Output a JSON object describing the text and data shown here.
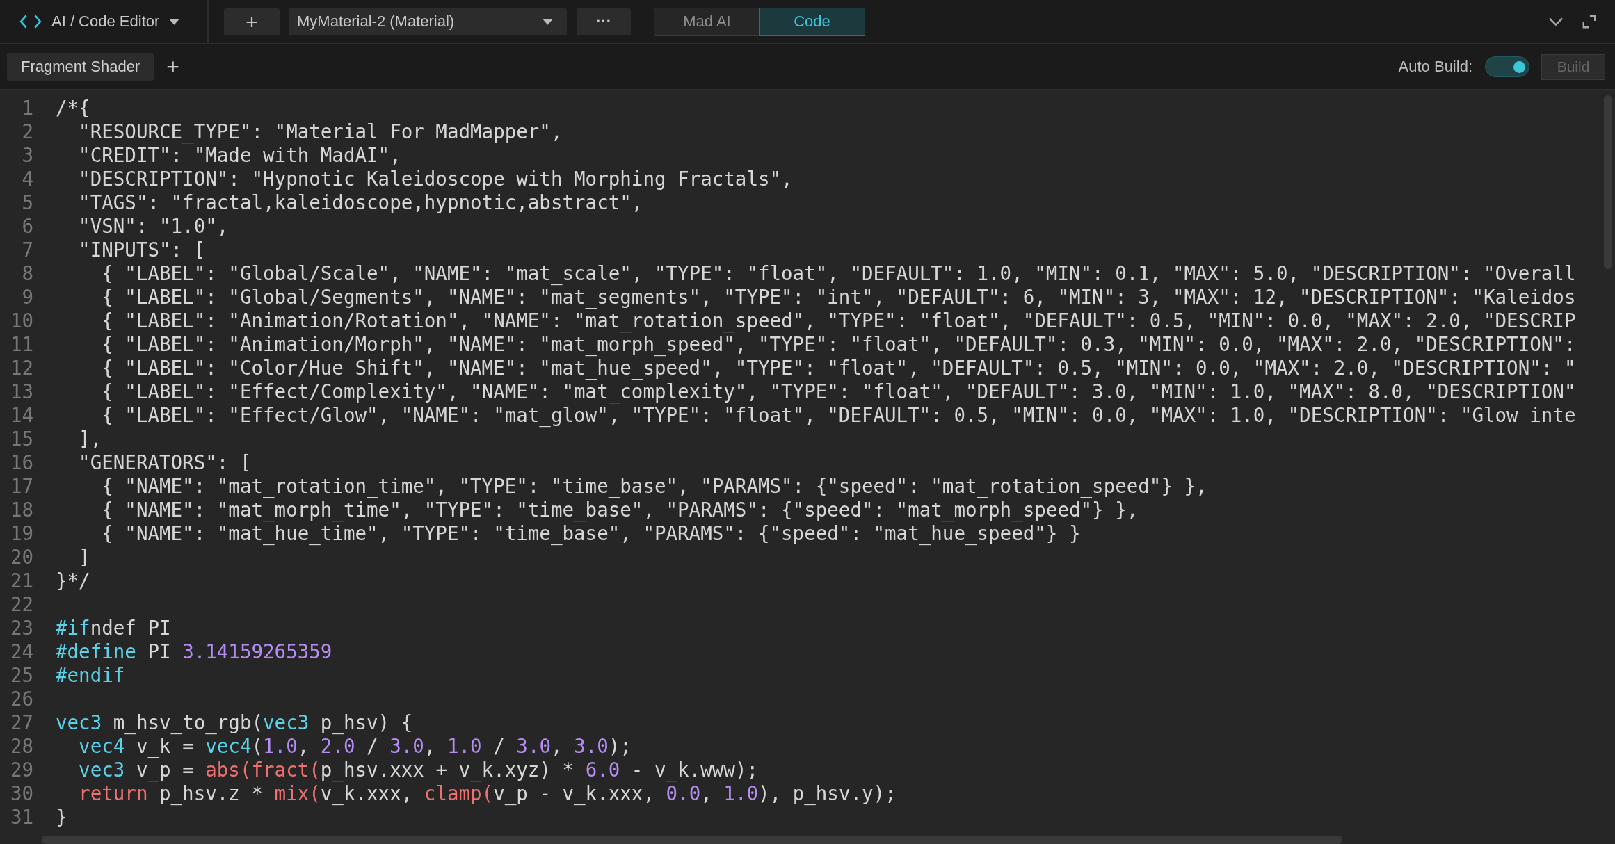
{
  "toolbar": {
    "title": "AI / Code Editor",
    "add_button": "+",
    "material_dropdown": "MyMaterial-2 (Material)",
    "more_button": "···",
    "modes": [
      {
        "label": "Mad AI",
        "selected": false
      },
      {
        "label": "Code",
        "selected": true
      }
    ]
  },
  "tab_bar": {
    "tabs": [
      {
        "label": "Fragment Shader",
        "selected": true
      }
    ],
    "add_tab": "+",
    "auto_build_label": "Auto Build:",
    "auto_build": {
      "on": true
    },
    "build_button": {
      "label": "Build",
      "disabled": true
    }
  },
  "editor": {
    "lines": [
      {
        "number": "1",
        "tokens": [
          {
            "kind": "plain",
            "text": "/*{"
          }
        ]
      },
      {
        "number": "2",
        "tokens": [
          {
            "kind": "plain",
            "text": "  \"RESOURCE_TYPE\": \"Material For MadMapper\","
          }
        ]
      },
      {
        "number": "3",
        "tokens": [
          {
            "kind": "plain",
            "text": "  \"CREDIT\": \"Made with MadAI\","
          }
        ]
      },
      {
        "number": "4",
        "tokens": [
          {
            "kind": "plain",
            "text": "  \"DESCRIPTION\": \"Hypnotic Kaleidoscope with Morphing Fractals\","
          }
        ]
      },
      {
        "number": "5",
        "tokens": [
          {
            "kind": "plain",
            "text": "  \"TAGS\": \"fractal,kaleidoscope,hypnotic,abstract\","
          }
        ]
      },
      {
        "number": "6",
        "tokens": [
          {
            "kind": "plain",
            "text": "  \"VSN\": \"1.0\","
          }
        ]
      },
      {
        "number": "7",
        "tokens": [
          {
            "kind": "plain",
            "text": "  \"INPUTS\": ["
          }
        ]
      },
      {
        "number": "8",
        "tokens": [
          {
            "kind": "plain",
            "text": "    { \"LABEL\": \"Global/Scale\", \"NAME\": \"mat_scale\", \"TYPE\": \"float\", \"DEFAULT\": 1.0, \"MIN\": 0.1, \"MAX\": 5.0, \"DESCRIPTION\": \"Overall"
          }
        ]
      },
      {
        "number": "9",
        "tokens": [
          {
            "kind": "plain",
            "text": "    { \"LABEL\": \"Global/Segments\", \"NAME\": \"mat_segments\", \"TYPE\": \"int\", \"DEFAULT\": 6, \"MIN\": 3, \"MAX\": 12, \"DESCRIPTION\": \"Kaleidos"
          }
        ]
      },
      {
        "number": "10",
        "tokens": [
          {
            "kind": "plain",
            "text": "    { \"LABEL\": \"Animation/Rotation\", \"NAME\": \"mat_rotation_speed\", \"TYPE\": \"float\", \"DEFAULT\": 0.5, \"MIN\": 0.0, \"MAX\": 2.0, \"DESCRIP"
          }
        ]
      },
      {
        "number": "11",
        "tokens": [
          {
            "kind": "plain",
            "text": "    { \"LABEL\": \"Animation/Morph\", \"NAME\": \"mat_morph_speed\", \"TYPE\": \"float\", \"DEFAULT\": 0.3, \"MIN\": 0.0, \"MAX\": 2.0, \"DESCRIPTION\":"
          }
        ]
      },
      {
        "number": "12",
        "tokens": [
          {
            "kind": "plain",
            "text": "    { \"LABEL\": \"Color/Hue Shift\", \"NAME\": \"mat_hue_speed\", \"TYPE\": \"float\", \"DEFAULT\": 0.5, \"MIN\": 0.0, \"MAX\": 2.0, \"DESCRIPTION\": \""
          }
        ]
      },
      {
        "number": "13",
        "tokens": [
          {
            "kind": "plain",
            "text": "    { \"LABEL\": \"Effect/Complexity\", \"NAME\": \"mat_complexity\", \"TYPE\": \"float\", \"DEFAULT\": 3.0, \"MIN\": 1.0, \"MAX\": 8.0, \"DESCRIPTION\""
          }
        ]
      },
      {
        "number": "14",
        "tokens": [
          {
            "kind": "plain",
            "text": "    { \"LABEL\": \"Effect/Glow\", \"NAME\": \"mat_glow\", \"TYPE\": \"float\", \"DEFAULT\": 0.5, \"MIN\": 0.0, \"MAX\": 1.0, \"DESCRIPTION\": \"Glow inte"
          }
        ]
      },
      {
        "number": "15",
        "tokens": [
          {
            "kind": "plain",
            "text": "  ],"
          }
        ]
      },
      {
        "number": "16",
        "tokens": [
          {
            "kind": "plain",
            "text": "  \"GENERATORS\": ["
          }
        ]
      },
      {
        "number": "17",
        "tokens": [
          {
            "kind": "plain",
            "text": "    { \"NAME\": \"mat_rotation_time\", \"TYPE\": \"time_base\", \"PARAMS\": {\"speed\": \"mat_rotation_speed\"} },"
          }
        ]
      },
      {
        "number": "18",
        "tokens": [
          {
            "kind": "plain",
            "text": "    { \"NAME\": \"mat_morph_time\", \"TYPE\": \"time_base\", \"PARAMS\": {\"speed\": \"mat_morph_speed\"} },"
          }
        ]
      },
      {
        "number": "19",
        "tokens": [
          {
            "kind": "plain",
            "text": "    { \"NAME\": \"mat_hue_time\", \"TYPE\": \"time_base\", \"PARAMS\": {\"speed\": \"mat_hue_speed\"} }"
          }
        ]
      },
      {
        "number": "20",
        "tokens": [
          {
            "kind": "plain",
            "text": "  ]"
          }
        ]
      },
      {
        "number": "21",
        "tokens": [
          {
            "kind": "plain",
            "text": "}*/"
          }
        ]
      },
      {
        "number": "22"
      },
      {
        "number": "23",
        "tokens": [
          {
            "kind": "keyword",
            "text": "#if"
          },
          {
            "kind": "plain",
            "text": "ndef PI"
          }
        ]
      },
      {
        "number": "24",
        "tokens": [
          {
            "kind": "keyword",
            "text": "#define"
          },
          {
            "kind": "plain",
            "text": " PI "
          },
          {
            "kind": "number",
            "text": "3.14159265359"
          }
        ]
      },
      {
        "number": "25",
        "tokens": [
          {
            "kind": "keyword",
            "text": "#endif"
          }
        ]
      },
      {
        "number": "26"
      },
      {
        "number": "27",
        "tokens": [
          {
            "kind": "keyword",
            "text": "vec3"
          },
          {
            "kind": "plain",
            "text": " m_hsv_to_rgb("
          },
          {
            "kind": "keyword",
            "text": "vec3"
          },
          {
            "kind": "plain",
            "text": " p_hsv) {"
          }
        ]
      },
      {
        "number": "28",
        "tokens": [
          {
            "kind": "keyword",
            "text": "  vec4"
          },
          {
            "kind": "plain",
            "text": " v_k = "
          },
          {
            "kind": "keyword",
            "text": "vec4"
          },
          {
            "kind": "plain",
            "text": "("
          },
          {
            "kind": "number",
            "text": "1.0"
          },
          {
            "kind": "plain",
            "text": ", "
          },
          {
            "kind": "number",
            "text": "2.0"
          },
          {
            "kind": "plain",
            "text": " / "
          },
          {
            "kind": "number",
            "text": "3.0"
          },
          {
            "kind": "plain",
            "text": ", "
          },
          {
            "kind": "number",
            "text": "1.0"
          },
          {
            "kind": "plain",
            "text": " / "
          },
          {
            "kind": "number",
            "text": "3.0"
          },
          {
            "kind": "plain",
            "text": ", "
          },
          {
            "kind": "number",
            "text": "3.0"
          },
          {
            "kind": "plain",
            "text": ");"
          }
        ]
      },
      {
        "number": "29",
        "tokens": [
          {
            "kind": "keyword",
            "text": "  vec3"
          },
          {
            "kind": "plain",
            "text": " v_p = "
          },
          {
            "kind": "function",
            "text": "abs("
          },
          {
            "kind": "function",
            "text": "fract("
          },
          {
            "kind": "plain",
            "text": "p_hsv.xxx + v_k.xyz) * "
          },
          {
            "kind": "number",
            "text": "6.0"
          },
          {
            "kind": "plain",
            "text": " - v_k.www);"
          }
        ]
      },
      {
        "number": "30",
        "tokens": [
          {
            "kind": "function",
            "text": "  return"
          },
          {
            "kind": "plain",
            "text": " p_hsv.z * "
          },
          {
            "kind": "function",
            "text": "mix("
          },
          {
            "kind": "plain",
            "text": "v_k.xxx, "
          },
          {
            "kind": "function",
            "text": "clamp("
          },
          {
            "kind": "plain",
            "text": "v_p - v_k.xxx, "
          },
          {
            "kind": "number",
            "text": "0.0"
          },
          {
            "kind": "plain",
            "text": ", "
          },
          {
            "kind": "number",
            "text": "1.0"
          },
          {
            "kind": "plain",
            "text": "), p_hsv.y);"
          }
        ]
      },
      {
        "number": "31",
        "tokens": [
          {
            "kind": "plain",
            "text": "}"
          }
        ]
      }
    ]
  }
}
